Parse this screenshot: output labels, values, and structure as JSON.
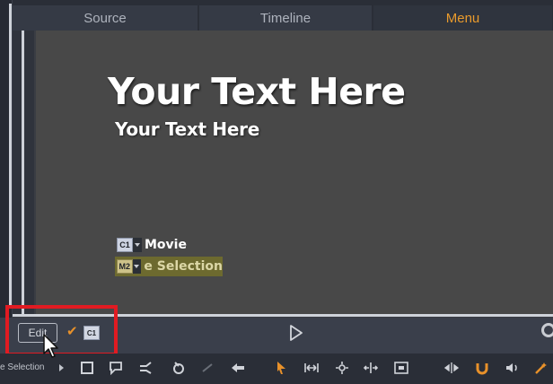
{
  "tabs": [
    {
      "label": "Source"
    },
    {
      "label": "Timeline"
    },
    {
      "label": "Menu"
    }
  ],
  "preview": {
    "title_big": "Your Text Here",
    "title_small": "Your Text Here",
    "buttons": [
      {
        "chip": "C1",
        "label": "Movie"
      },
      {
        "chip": "M2",
        "label": "e Selection"
      }
    ]
  },
  "transport": {
    "edit_label": "Edit",
    "chip_label": "C1"
  },
  "toolbar": {
    "left_label": "e Selection"
  },
  "colors": {
    "accent": "#e99a2c",
    "highlight_box": "#e11b22"
  }
}
